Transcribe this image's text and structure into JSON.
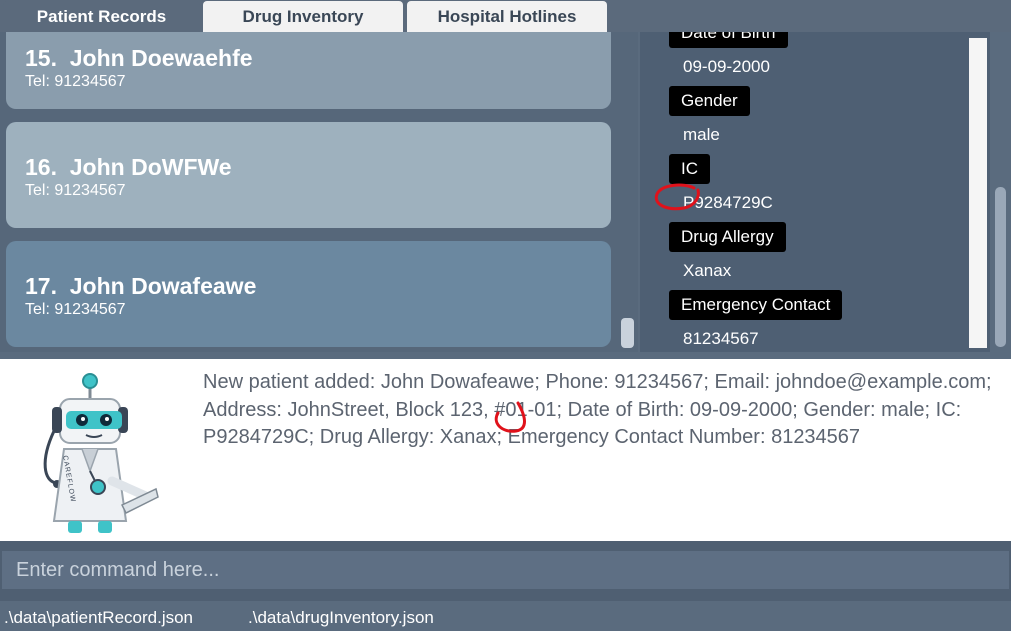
{
  "tabs": [
    {
      "label": "Patient Records",
      "active": true
    },
    {
      "label": "Drug Inventory",
      "active": false
    },
    {
      "label": "Hospital Hotlines",
      "active": false
    }
  ],
  "patients": [
    {
      "index": "15.",
      "name": "John Doewaehfe",
      "tel": "Tel: 91234567",
      "color": "#8a9dad"
    },
    {
      "index": "16.",
      "name": "John DoWFWe",
      "tel": "Tel: 91234567",
      "color": "#9eb1be"
    },
    {
      "index": "17.",
      "name": "John Dowafeawe",
      "tel": "Tel: 91234567",
      "color": "#6b88a0"
    }
  ],
  "detail": {
    "dob_label": "Date of Birth",
    "dob": "09-09-2000",
    "gender_label": "Gender",
    "gender": "male",
    "ic_label": "IC",
    "ic": "P9284729C",
    "allergy_label": "Drug Allergy",
    "allergy": "Xanax",
    "emergency_label": "Emergency Contact",
    "emergency": "81234567"
  },
  "result": {
    "message": "New patient added: John Dowafeawe; Phone: 91234567; Email: johndoe@example.com; Address: JohnStreet, Block 123, #01-01; Date of Birth: 09-09-2000; Gender: male; IC: P9284729C; Drug Allergy: Xanax; Emergency Contact Number: 81234567",
    "robot_label": "CAREFLOW"
  },
  "command": {
    "placeholder": "Enter command here..."
  },
  "status": {
    "patient_file": ".\\data\\patientRecord.json",
    "drug_file": ".\\data\\drugInventory.json"
  },
  "colors": {
    "accent": "#5a6b7e",
    "annotation": "#e0121b"
  }
}
